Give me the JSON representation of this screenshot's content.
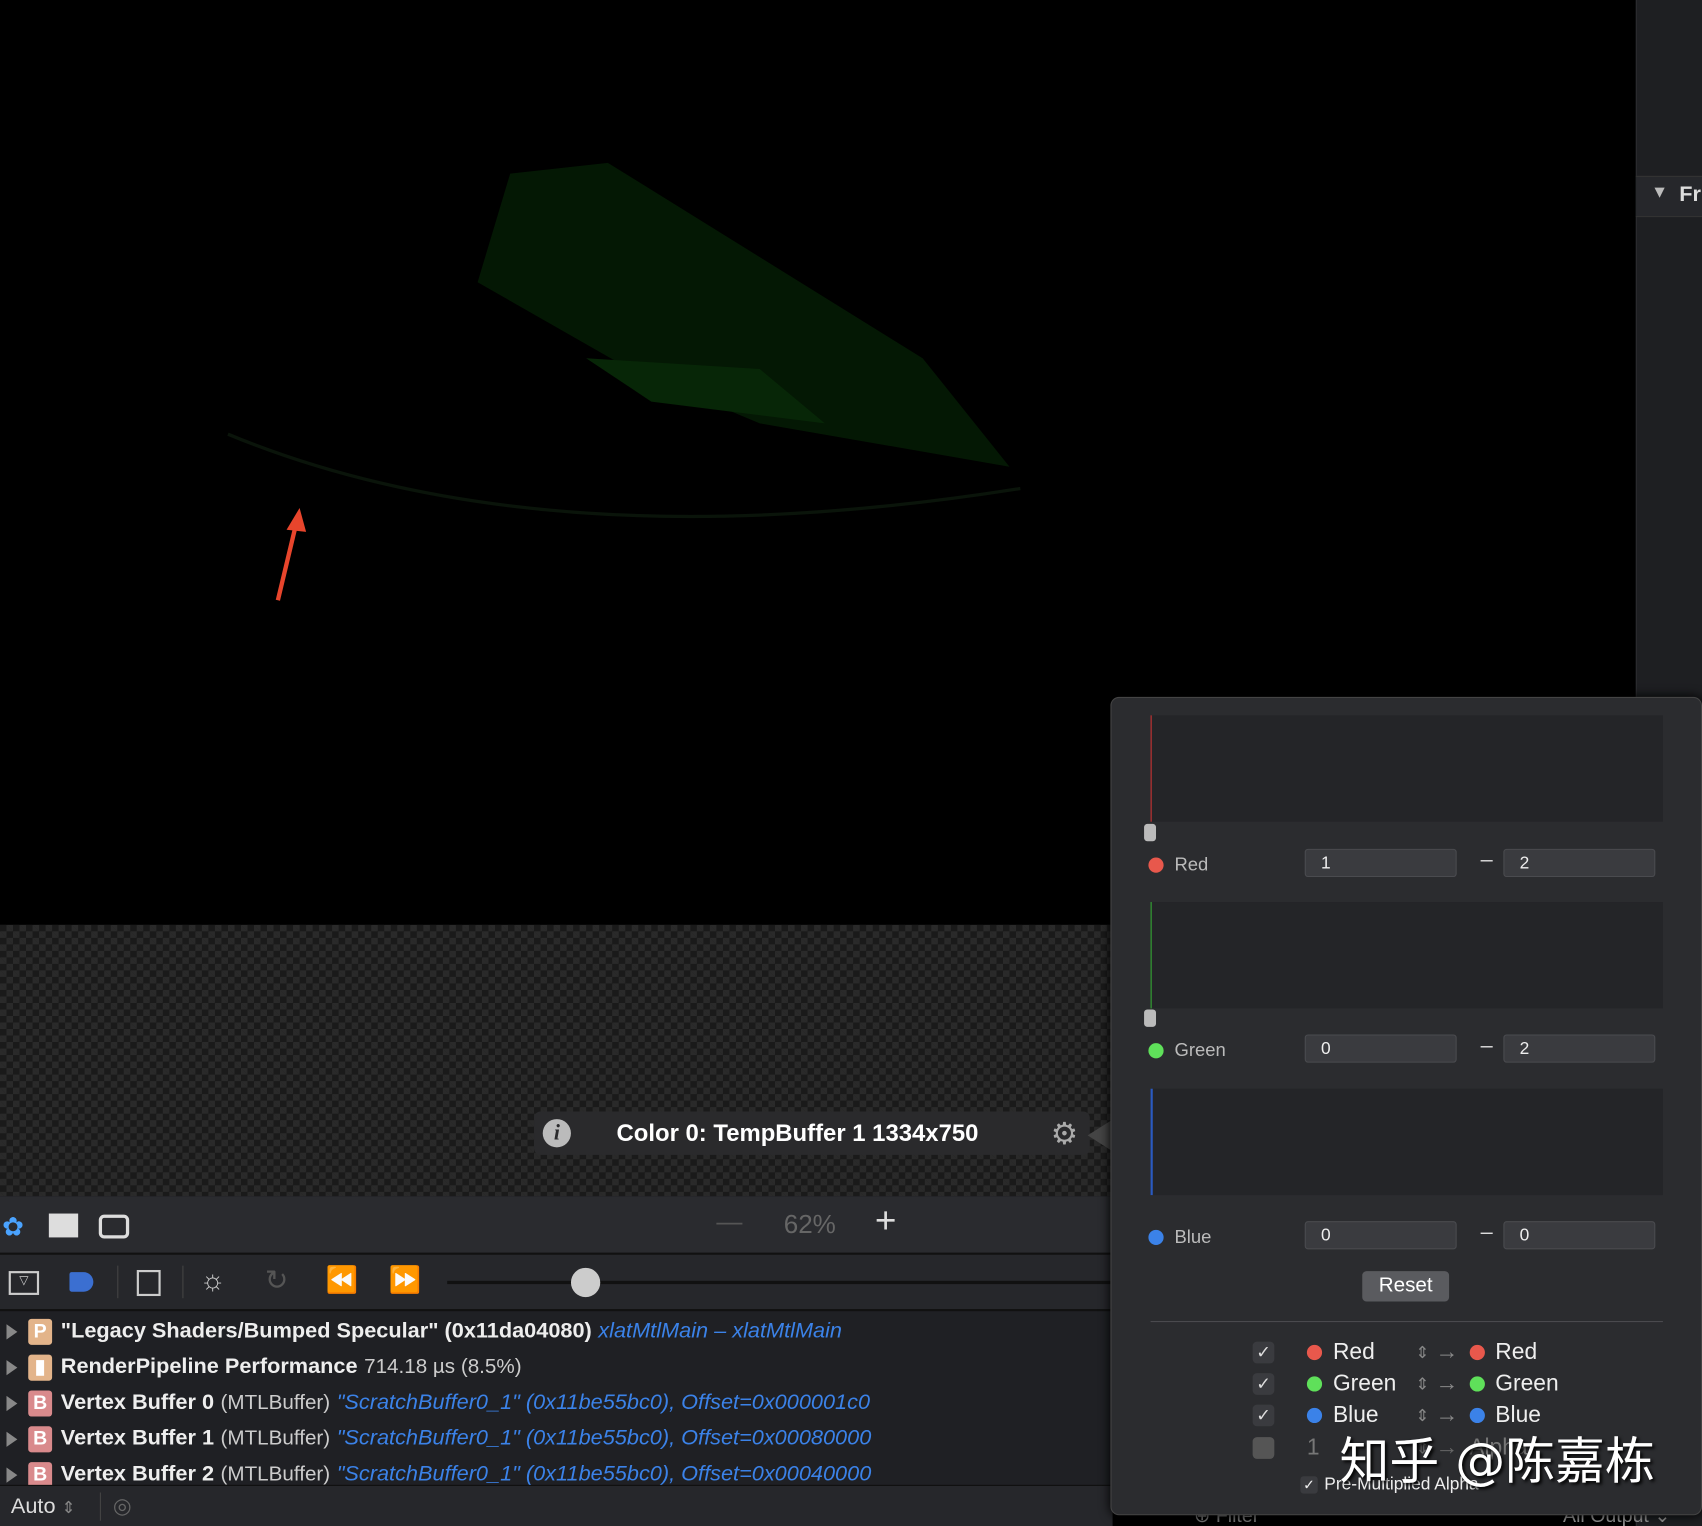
{
  "right_pane": {
    "section_label": "Fr"
  },
  "viewer": {
    "info_label": "Color 0: TempBuffer 1 1334x750"
  },
  "toolbar": {
    "zoom_level": "62%",
    "zoom_out": "—",
    "zoom_in": "+"
  },
  "list": [
    {
      "badge": "P",
      "bold": "\"Legacy Shaders/Bumped Specular\" (0x11da04080)",
      "normal": "",
      "link": "xlatMtlMain – xlatMtlMain"
    },
    {
      "badge": "perf",
      "bold": "RenderPipeline Performance",
      "normal": "714.18 µs (8.5%)",
      "link": ""
    },
    {
      "badge": "B",
      "bold": "Vertex Buffer 0",
      "normal": "(MTLBuffer)",
      "link": "\"ScratchBuffer0_1\" (0x11be55bc0), Offset=0x000001c0"
    },
    {
      "badge": "B",
      "bold": "Vertex Buffer 1",
      "normal": "(MTLBuffer)",
      "link": "\"ScratchBuffer0_1\" (0x11be55bc0), Offset=0x00080000"
    },
    {
      "badge": "B",
      "bold": "Vertex Buffer 2",
      "normal": "(MTLBuffer)",
      "link": "\"ScratchBuffer0_1\" (0x11be55bc0), Offset=0x00040000"
    }
  ],
  "status": {
    "mode": "Auto",
    "filter_placeholder": "Filter",
    "output": "All Output"
  },
  "popup": {
    "channels": [
      {
        "name": "Red",
        "min": "1",
        "max": "2",
        "color": "#e8584c"
      },
      {
        "name": "Green",
        "min": "0",
        "max": "2",
        "color": "#5fe05a"
      },
      {
        "name": "Blue",
        "min": "0",
        "max": "0",
        "color": "#3b82e8"
      }
    ],
    "range_sep": "–",
    "reset_label": "Reset",
    "mapping": [
      {
        "checked": true,
        "src": "Red",
        "dst": "Red",
        "color": "#e8584c"
      },
      {
        "checked": true,
        "src": "Green",
        "dst": "Green",
        "color": "#5fe05a"
      },
      {
        "checked": true,
        "src": "Blue",
        "dst": "Blue",
        "color": "#3b82e8"
      },
      {
        "checked": false,
        "src": "1",
        "dst": "Alpha"
      }
    ],
    "premultiplied_label": "Pre-Multiplied Alpha"
  },
  "watermark": "知乎 @陈嘉栋"
}
